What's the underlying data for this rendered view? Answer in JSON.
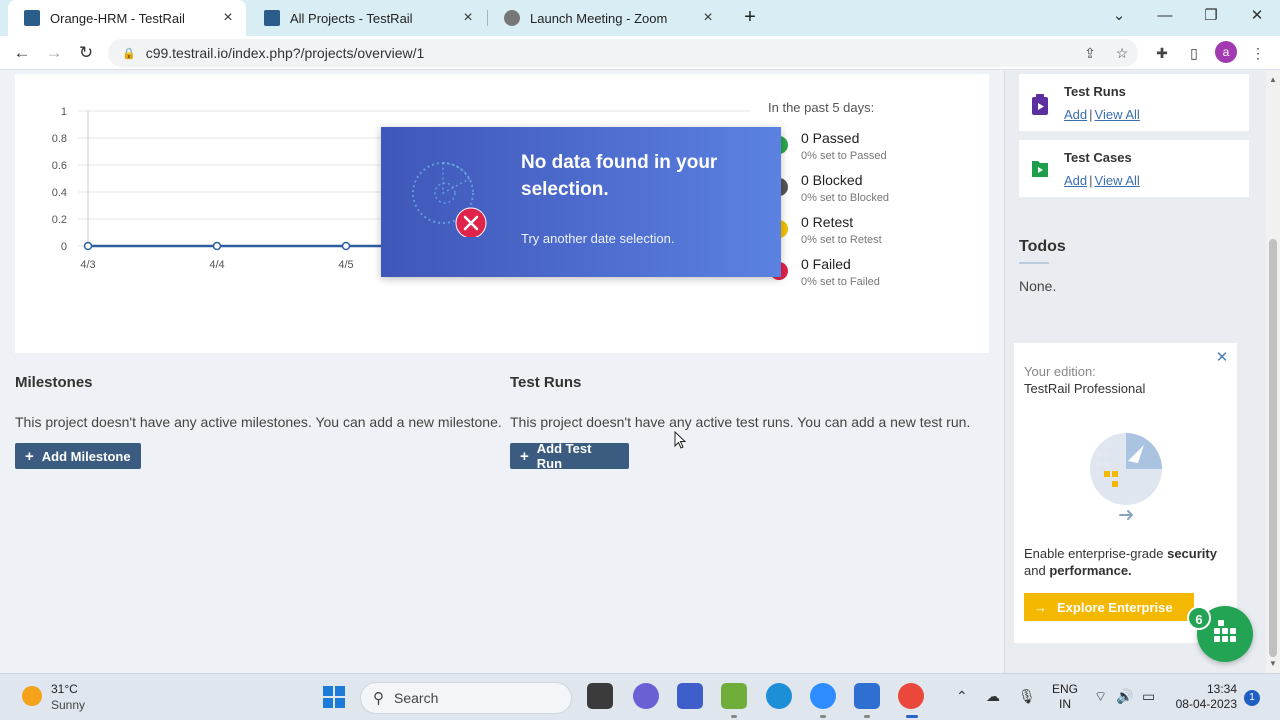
{
  "browser": {
    "tabs": [
      {
        "label": "Orange-HRM - TestRail",
        "active": true
      },
      {
        "label": "All Projects - TestRail",
        "active": false
      },
      {
        "label": "Launch Meeting - Zoom",
        "active": false
      }
    ],
    "url": "c99.testrail.io/index.php?/projects/overview/1",
    "profile_initial": "a"
  },
  "chart": {
    "y_ticks": [
      "1",
      "0.8",
      "0.6",
      "0.4",
      "0.2",
      "0"
    ],
    "x_ticks": [
      "4/3",
      "4/4",
      "4/5"
    ]
  },
  "chart_data": {
    "type": "line",
    "x": [
      "4/3",
      "4/4",
      "4/5"
    ],
    "series": [
      {
        "values": [
          0,
          0,
          0
        ]
      }
    ],
    "ylim": [
      0,
      1
    ]
  },
  "summary": {
    "title": "In the past 5 days:",
    "items": [
      {
        "label": "0 Passed",
        "sub": "0% set to Passed",
        "color": "#2aa84a"
      },
      {
        "label": "0 Blocked",
        "sub": "0% set to Blocked",
        "color": "#555555"
      },
      {
        "label": "0 Retest",
        "sub": "0% set to Retest",
        "color": "#f2c200"
      },
      {
        "label": "0 Failed",
        "sub": "0% set to Failed",
        "color": "#e0234a"
      }
    ]
  },
  "nodata": {
    "title": "No data found in your selection.",
    "subtitle": "Try another date selection."
  },
  "milestones": {
    "title": "Milestones",
    "text": "This project doesn't have any active milestones. You can add a new milestone.",
    "button": "Add Milestone"
  },
  "testruns": {
    "title": "Test Runs",
    "text": "This project doesn't have any active test runs. You can add a new test run.",
    "button": "Add Test Run"
  },
  "sidebar": {
    "cards": [
      {
        "title": "Test Runs",
        "add": "Add",
        "sep": "|",
        "view": "View All"
      },
      {
        "title": "Test Cases",
        "add": "Add",
        "sep": "|",
        "view": "View All"
      }
    ],
    "todos_title": "Todos",
    "todos_value": "None.",
    "edition": {
      "label": "Your edition:",
      "name": "TestRail Professional",
      "text_pre": "Enable enterprise-grade ",
      "text_b1": "security",
      "text_mid": " and ",
      "text_b2": "performance.",
      "button": "Explore Enterprise"
    },
    "chat_badge": "6"
  },
  "taskbar": {
    "temp": "31°C",
    "condition": "Sunny",
    "search": "Search",
    "lang_line1": "ENG",
    "lang_line2": "IN",
    "time": "13:34",
    "date": "08-04-2023",
    "notifications": "1"
  }
}
